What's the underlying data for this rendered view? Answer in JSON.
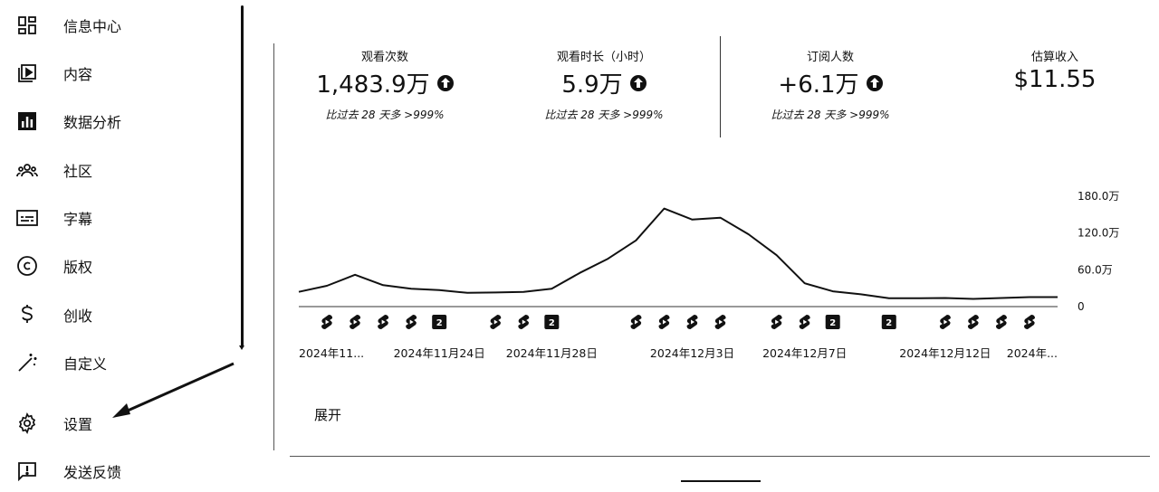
{
  "sidebar": {
    "items": [
      {
        "label": "信息中心",
        "icon": "dashboard-icon"
      },
      {
        "label": "内容",
        "icon": "video-library-icon"
      },
      {
        "label": "数据分析",
        "icon": "analytics-icon"
      },
      {
        "label": "社区",
        "icon": "community-icon"
      },
      {
        "label": "字幕",
        "icon": "subtitles-icon"
      },
      {
        "label": "版权",
        "icon": "copyright-icon"
      },
      {
        "label": "创收",
        "icon": "dollar-icon"
      },
      {
        "label": "自定义",
        "icon": "magic-wand-icon"
      },
      {
        "label": "设置",
        "icon": "gear-icon"
      },
      {
        "label": "发送反馈",
        "icon": "feedback-icon"
      }
    ]
  },
  "stats": [
    {
      "title": "观看次数",
      "value": "1,483.9万",
      "sub": "比过去 28 天多 >999%",
      "trend": "up"
    },
    {
      "title": "观看时长（小时）",
      "value": "5.9万",
      "sub": "比过去 28 天多 >999%",
      "trend": "up"
    },
    {
      "title": "订阅人数",
      "value": "+6.1万",
      "sub": "比过去 28 天多 >999%",
      "trend": "up"
    },
    {
      "title": "估算收入",
      "value": "$11.55",
      "sub": "",
      "trend": ""
    }
  ],
  "expand_label": "展开",
  "chart_data": {
    "type": "line",
    "x_tick_labels": [
      "2024年11...",
      "2024年11月24日",
      "2024年11月28日",
      "2024年12月3日",
      "2024年12月7日",
      "2024年12月12日",
      "2024年..."
    ],
    "y_tick_labels": [
      "180.0万",
      "120.0万",
      "60.0万",
      "0"
    ],
    "ylim": [
      0,
      1800000
    ],
    "values": [
      240000,
      340000,
      520000,
      350000,
      290000,
      270000,
      225000,
      230000,
      240000,
      290000,
      550000,
      780000,
      1080000,
      1600000,
      1420000,
      1450000,
      1180000,
      840000,
      380000,
      250000,
      200000,
      135000,
      135000,
      140000,
      125000,
      140000,
      155000,
      155000
    ],
    "markers": [
      {
        "index": 1,
        "kind": "shorts"
      },
      {
        "index": 2,
        "kind": "shorts"
      },
      {
        "index": 3,
        "kind": "shorts"
      },
      {
        "index": 4,
        "kind": "shorts"
      },
      {
        "index": 5,
        "kind": "multi",
        "count": "2"
      },
      {
        "index": 7,
        "kind": "shorts"
      },
      {
        "index": 8,
        "kind": "shorts"
      },
      {
        "index": 9,
        "kind": "multi",
        "count": "2"
      },
      {
        "index": 12,
        "kind": "shorts"
      },
      {
        "index": 13,
        "kind": "shorts"
      },
      {
        "index": 14,
        "kind": "shorts"
      },
      {
        "index": 15,
        "kind": "shorts"
      },
      {
        "index": 17,
        "kind": "shorts"
      },
      {
        "index": 18,
        "kind": "shorts"
      },
      {
        "index": 19,
        "kind": "multi",
        "count": "2"
      },
      {
        "index": 21,
        "kind": "multi",
        "count": "2"
      },
      {
        "index": 23,
        "kind": "shorts"
      },
      {
        "index": 24,
        "kind": "shorts"
      },
      {
        "index": 25,
        "kind": "shorts"
      },
      {
        "index": 26,
        "kind": "shorts"
      }
    ],
    "grid": false,
    "color": "#111111"
  }
}
